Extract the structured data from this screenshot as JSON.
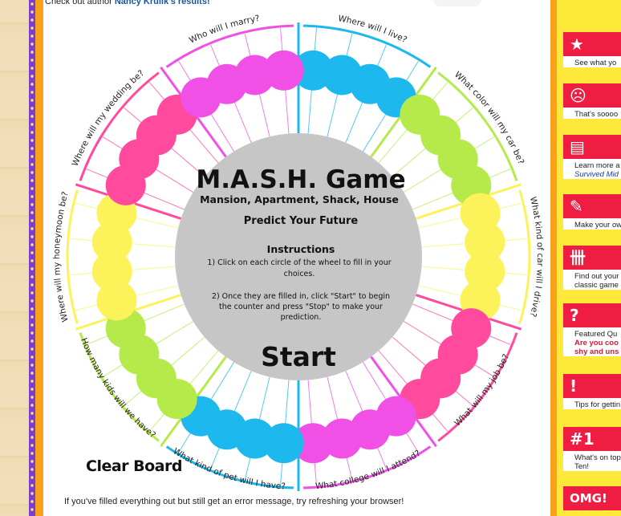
{
  "page": {
    "author_note_prefix": "Check out author ",
    "author_link": "Nancy Krulik's results!",
    "clear_board": "Clear Board",
    "error_note": "If you've filled everything out but still get an error message, try refreshing your browser!"
  },
  "game": {
    "title": "M.A.S.H. Game",
    "subtitle": "Mansion, Apartment, Shack, House",
    "tagline": "Predict Your Future",
    "instructions_heading": "Instructions",
    "instruction_1_line1": "1) Click on each circle of the wheel to fill in your",
    "instruction_1_line2": "choices.",
    "instruction_2_line1": "2) Once they are filled in, click \"Start\" to begin",
    "instruction_2_line2": "the counter and press \"Stop\" to make your",
    "instruction_2_line3": "prediction.",
    "start": "Start"
  },
  "categories": [
    {
      "label": "Where will I live?",
      "color": "#1cb8ee"
    },
    {
      "label": "What color will my car be?",
      "color": "#b5ea4a"
    },
    {
      "label": "What kind of car will I drive?",
      "color": "#fcf35a"
    },
    {
      "label": "What will my job be?",
      "color": "#ff4a9e"
    },
    {
      "label": "What college will I attend?",
      "color": "#f050e6"
    },
    {
      "label": "What kind of pet will I have?",
      "color": "#1cb8ee"
    },
    {
      "label": "How many kids will we have?",
      "color": "#b5ea4a"
    },
    {
      "label": "Where will my honeymoon be?",
      "color": "#fcf35a"
    },
    {
      "label": "Where will my wedding be?",
      "color": "#ff4a9e"
    },
    {
      "label": "Who will I marry?",
      "color": "#f050e6"
    }
  ],
  "sidebar": {
    "items": [
      {
        "icon": "★",
        "text1": "See what yo",
        "text2": ""
      },
      {
        "icon": "☹",
        "text1": "That's soooo",
        "text2": ""
      },
      {
        "icon": "▤",
        "text1": "Learn more a",
        "text2": "Survived Mid"
      },
      {
        "icon": "✎",
        "text1": "Make your ow",
        "text2": ""
      },
      {
        "icon": "卌",
        "text1": "Find out your",
        "text2": "classic game"
      },
      {
        "icon": "?",
        "text1": "Featured Qu",
        "text2": "Are you coo",
        "text3": "shy and uns"
      },
      {
        "icon": "!",
        "text1": "Tips for gettin",
        "text2": ""
      },
      {
        "icon": "#1",
        "text1": "What's on top",
        "text2": "Ten!"
      },
      {
        "icon": "OMG!",
        "text1": "",
        "text2": ""
      }
    ]
  }
}
